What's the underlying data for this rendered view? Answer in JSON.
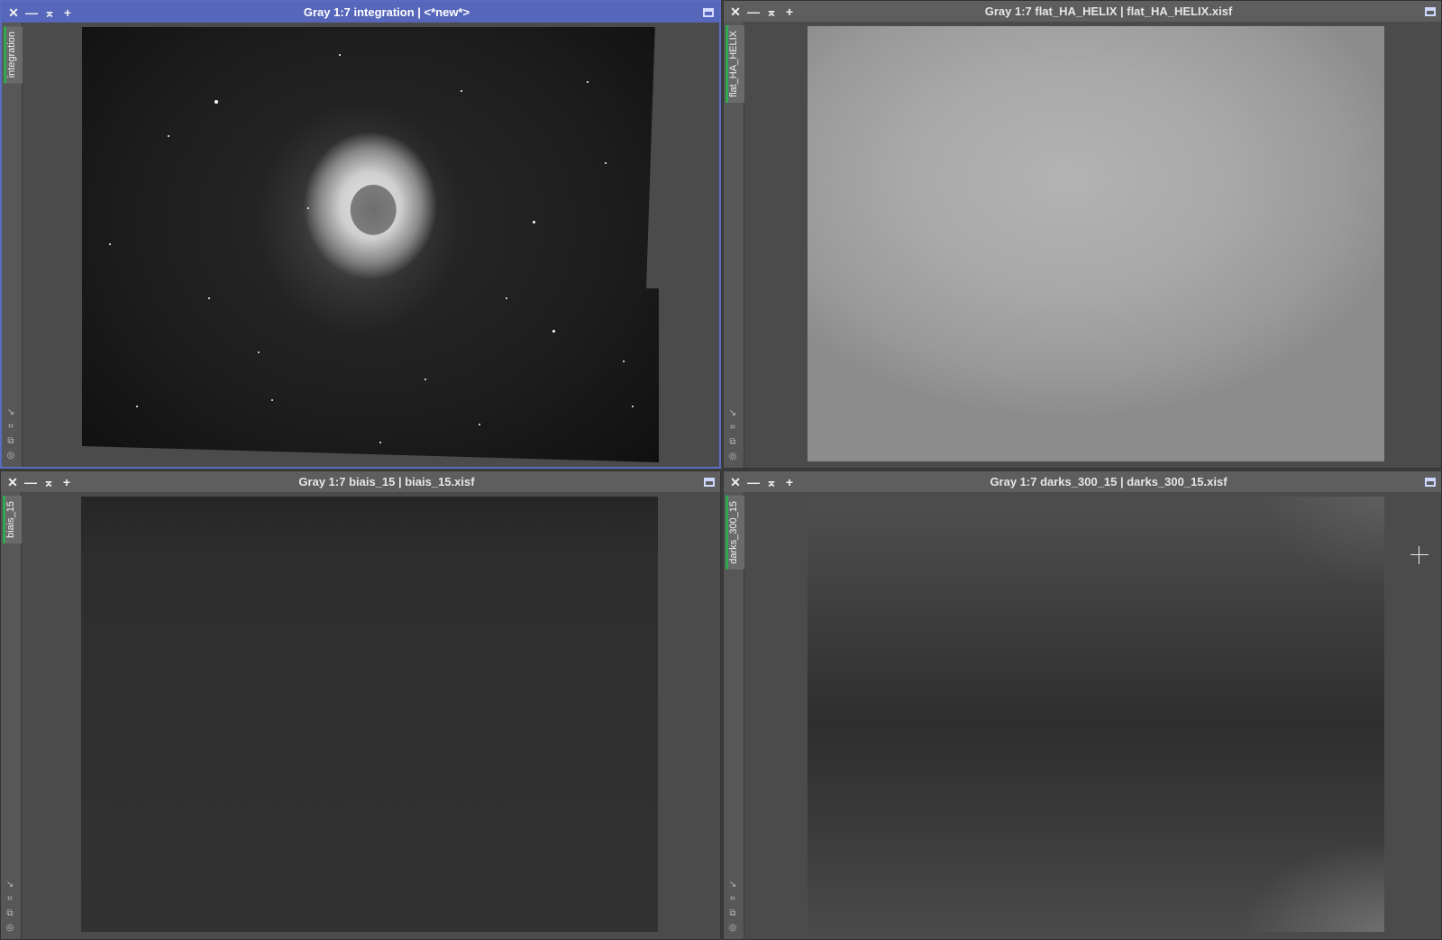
{
  "windows": [
    {
      "title": "Gray 1:7 integration | <*new*>",
      "tab_label": "integration",
      "active": true
    },
    {
      "title": "Gray 1:7 flat_HA_HELIX | flat_HA_HELIX.xisf",
      "tab_label": "flat_HA_HELIX",
      "active": false
    },
    {
      "title": "Gray 1:7 biais_15 | biais_15.xisf",
      "tab_label": "biais_15",
      "active": false
    },
    {
      "title": "Gray 1:7 darks_300_15 | darks_300_15.xisf",
      "tab_label": "darks_300_15",
      "active": false
    }
  ],
  "titlebar_buttons": {
    "close": "✕",
    "shade": "—",
    "iconize": "⌅",
    "extend": "+"
  },
  "side_icons": [
    "arrow-icon",
    "crop-icon",
    "clone-icon",
    "target-icon"
  ],
  "colors": {
    "active_titlebar": "#5566bb",
    "tab_accent": "#2fa84f"
  }
}
